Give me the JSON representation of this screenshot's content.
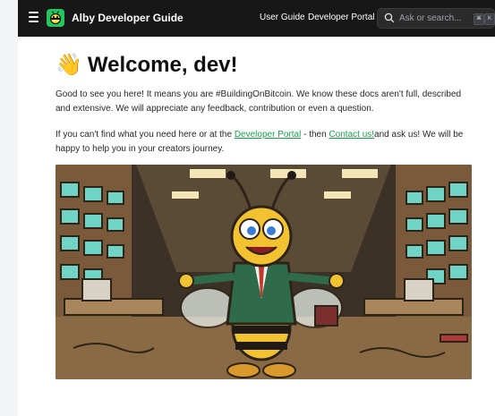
{
  "header": {
    "brand": "Alby Developer Guide",
    "nav": [
      "User Guide",
      "Developer Portal"
    ],
    "search_placeholder": "Ask or search...",
    "shortcut_keys": [
      "⌘",
      "K"
    ]
  },
  "main": {
    "title": "Welcome, dev!",
    "title_emoji": "👋",
    "paragraph1": "Good to see you here! It means you are #BuildingOnBitcoin. We know these docs aren't full, described and extensive. We will appreciate any feedback, contribution or even a question.",
    "paragraph2": {
      "before": "If you can't find what you need here or at the ",
      "link1": "Developer Portal",
      "middle": " - then ",
      "link2": "Contact us!",
      "after": "and ask us! We will be happy to help you in your creators journey."
    }
  },
  "colors": {
    "topbar": "#171717",
    "brand_green": "#22c55e",
    "link": "#16a34a"
  }
}
